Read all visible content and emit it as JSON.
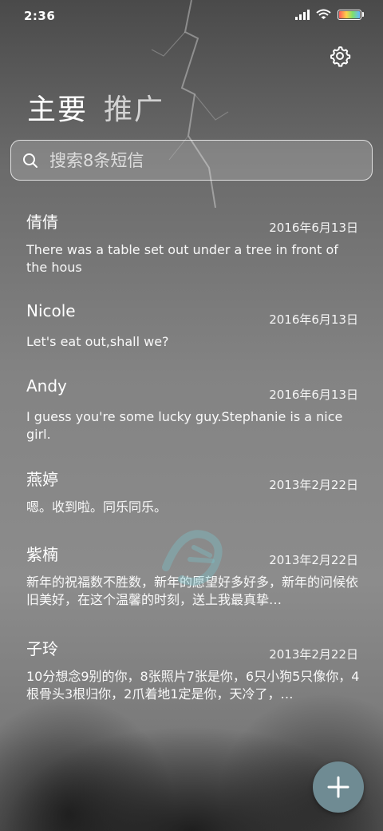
{
  "status_bar": {
    "time": "2:36",
    "icons": [
      "signal-icon",
      "wifi-icon",
      "battery-icon"
    ]
  },
  "header": {
    "tabs": [
      {
        "label": "主要",
        "active": true
      },
      {
        "label": "推广",
        "active": false
      }
    ],
    "settings_icon": "gear-icon"
  },
  "search": {
    "placeholder": "搜索8条短信",
    "value": ""
  },
  "messages": [
    {
      "name": "倩倩",
      "date": "2016年6月13日",
      "preview": "There was a table set out under a tree in front of the hous"
    },
    {
      "name": "Nicole",
      "date": "2016年6月13日",
      "preview": "Let's eat out,shall we?"
    },
    {
      "name": "Andy",
      "date": "2016年6月13日",
      "preview": "I guess you're some lucky guy.Stephanie is a nice girl."
    },
    {
      "name": "燕婷",
      "date": "2013年2月22日",
      "preview": "嗯。收到啦。同乐同乐。"
    },
    {
      "name": "紫楠",
      "date": "2013年2月22日",
      "preview": "新年的祝福数不胜数，新年的愿望好多好多，新年的问候依旧美好，在这个温馨的时刻，送上我最真挚…"
    },
    {
      "name": "子玲",
      "date": "2013年2月22日",
      "preview": "10分想念9别的你，8张照片7张是你，6只小狗5只像你，4根骨头3根归你，2爪着地1定是你，天冷了，…"
    }
  ],
  "fab": {
    "icon": "plus-icon"
  },
  "colors": {
    "fab": "#6f8b93",
    "text": "#ffffff"
  }
}
